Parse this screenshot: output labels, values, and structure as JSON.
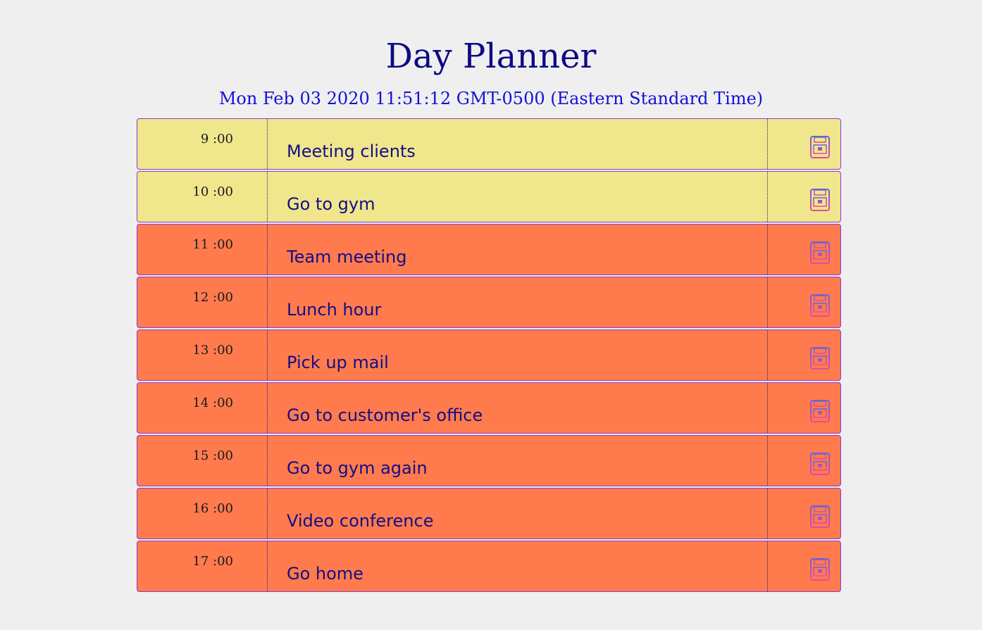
{
  "header": {
    "title": "Day Planner",
    "date": "Mon Feb 03 2020 11:51:12 GMT-0500 (Eastern Standard Time)"
  },
  "colors": {
    "past": "#f0e68c",
    "present": "#ff7b4d",
    "border": "#8f3bd3",
    "text": "#130e86"
  },
  "icons": {
    "save": "floppy-disk-icon"
  },
  "rows": [
    {
      "hour": "9 :00",
      "text": "Meeting clients",
      "state": "past"
    },
    {
      "hour": "10 :00",
      "text": "Go to gym",
      "state": "past"
    },
    {
      "hour": "11 :00",
      "text": "Team meeting",
      "state": "present"
    },
    {
      "hour": "12 :00",
      "text": "Lunch hour",
      "state": "present"
    },
    {
      "hour": "13 :00",
      "text": "Pick up mail",
      "state": "present"
    },
    {
      "hour": "14 :00",
      "text": "Go to customer's office",
      "state": "present"
    },
    {
      "hour": "15 :00",
      "text": "Go to gym again",
      "state": "present"
    },
    {
      "hour": "16 :00",
      "text": "Video conference",
      "state": "present"
    },
    {
      "hour": "17 :00",
      "text": "Go home",
      "state": "present"
    }
  ]
}
